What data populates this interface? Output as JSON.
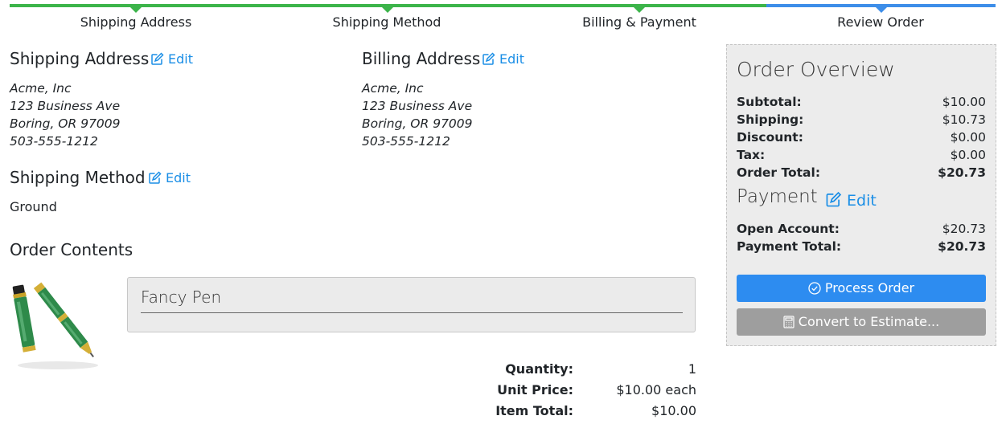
{
  "steps": [
    {
      "label": "Shipping Address",
      "state": "complete"
    },
    {
      "label": "Shipping Method",
      "state": "complete"
    },
    {
      "label": "Billing & Payment",
      "state": "complete"
    },
    {
      "label": "Review Order",
      "state": "active"
    }
  ],
  "colors": {
    "complete": "#3cb44a",
    "active": "#3d8ee9",
    "link": "#1a8ee6",
    "primary_button": "#2d8cf0",
    "secondary_button": "#9e9e9e"
  },
  "shipping_address": {
    "heading": "Shipping Address",
    "edit_label": "Edit",
    "lines": [
      "Acme, Inc",
      "123 Business Ave",
      "Boring, OR 97009",
      "503-555-1212"
    ]
  },
  "billing_address": {
    "heading": "Billing Address",
    "edit_label": "Edit",
    "lines": [
      "Acme, Inc",
      "123 Business Ave",
      "Boring, OR 97009",
      "503-555-1212"
    ]
  },
  "shipping_method": {
    "heading": "Shipping Method",
    "edit_label": "Edit",
    "value": "Ground"
  },
  "order_contents": {
    "heading": "Order Contents",
    "item": {
      "name": "Fancy Pen",
      "image_icon": "pen-product-image",
      "quantity_label": "Quantity:",
      "quantity": "1",
      "unit_price_label": "Unit Price:",
      "unit_price": "$10.00 each",
      "item_total_label": "Item Total:",
      "item_total": "$10.00"
    }
  },
  "overview": {
    "title": "Order Overview",
    "rows": [
      {
        "label": "Subtotal:",
        "value": "$10.00"
      },
      {
        "label": "Shipping:",
        "value": "$10.73"
      },
      {
        "label": "Discount:",
        "value": "$0.00"
      },
      {
        "label": "Tax:",
        "value": "$0.00"
      },
      {
        "label": "Order Total:",
        "value": "$20.73"
      }
    ],
    "payment_title": "Payment",
    "payment_edit_label": "Edit",
    "payment_rows": [
      {
        "label": "Open Account:",
        "value": "$20.73"
      },
      {
        "label": "Payment Total:",
        "value": "$20.73"
      }
    ],
    "process_button": "Process Order",
    "estimate_button": "Convert to Estimate..."
  }
}
